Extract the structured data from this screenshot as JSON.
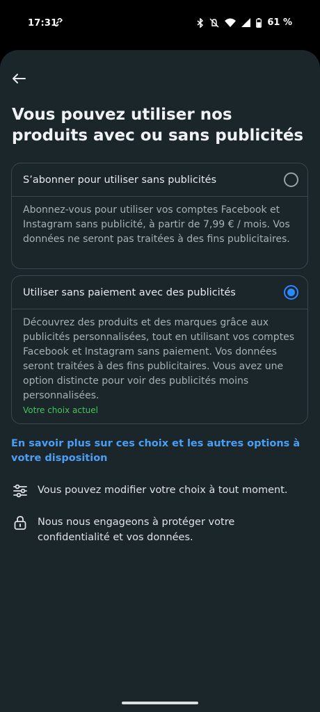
{
  "status_bar": {
    "time": "17:31",
    "battery": "61 %"
  },
  "header": {
    "title": "Vous pouvez utiliser nos produits avec ou sans publicités"
  },
  "options": [
    {
      "label": "S’abonner pour utiliser sans publicités",
      "description": "Abonnez-vous pour utiliser vos comptes Facebook et Instagram sans publicité, à partir de 7,99 € / mois. Vos données ne seront pas traitées à des fins publicitaires.",
      "selected": false
    },
    {
      "label": "Utiliser sans paiement avec des publicités",
      "description": "Découvrez des produits et des marques grâce aux publicités personnalisées, tout en utilisant vos comptes Facebook et Instagram sans paiement. Vos données seront traitées à des fins publicitaires. Vous avez une option distincte pour voir des publicités moins personnalisées.",
      "badge": "Votre choix actuel",
      "selected": true
    }
  ],
  "learn_more_link": "En savoir plus sur ces choix et les autres options à votre disposition",
  "info": [
    {
      "icon": "sliders-icon",
      "text": "Vous pouvez modifier votre choix à tout moment."
    },
    {
      "icon": "lock-icon",
      "text": "Nous nous engageons à protéger votre confidentialité et vos données."
    }
  ],
  "colors": {
    "background": "#1b262b",
    "accent": "#2d88ff",
    "link": "#4a9ff5",
    "current_choice": "#47c35c"
  }
}
